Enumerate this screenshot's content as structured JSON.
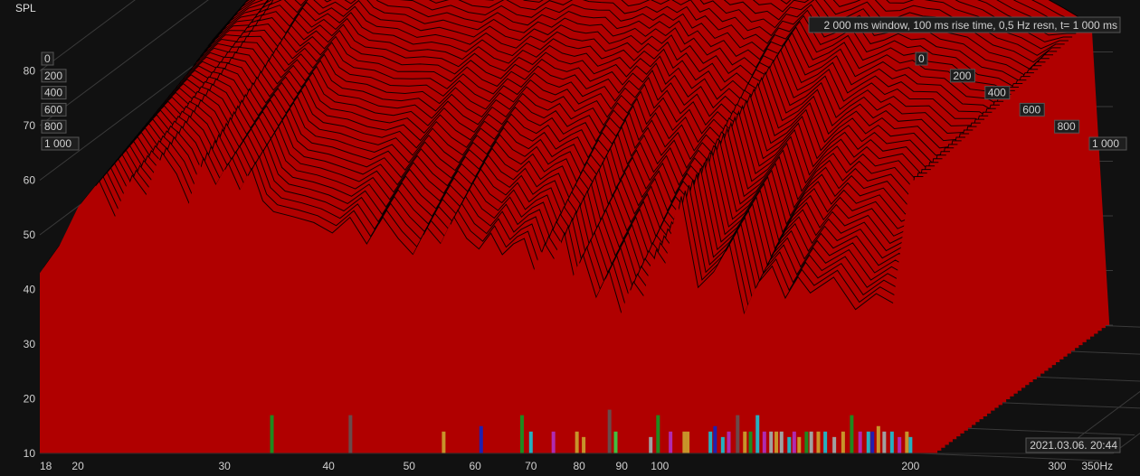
{
  "chart_data": {
    "type": "area",
    "ylabel": "SPL",
    "x_unit": "Hz",
    "x_scale": "log",
    "xlim": [
      18,
      350
    ],
    "ylim": [
      10,
      90
    ],
    "x_ticks": [
      18,
      20,
      30,
      40,
      50,
      60,
      70,
      80,
      90,
      100,
      200,
      300,
      350
    ],
    "x_tick_labels": [
      "18",
      "20",
      "30",
      "40",
      "50",
      "60",
      "70",
      "80",
      "90",
      "100",
      "200",
      "300",
      "350Hz"
    ],
    "y_ticks": [
      10,
      20,
      30,
      40,
      50,
      60,
      70,
      80
    ],
    "y_tick_labels": [
      "10",
      "20",
      "30",
      "40",
      "50",
      "60",
      "70",
      "80"
    ],
    "time_axis_ms": [
      0,
      200,
      400,
      600,
      800,
      1000
    ],
    "time_axis_labels": [
      "0",
      "200",
      "400",
      "600",
      "800",
      "1 000"
    ],
    "annotation": "2 000 ms window, 100 ms rise time,  0,5 Hz resn, t= 1 000 ms",
    "timestamp": "2021.03.06. 20:44",
    "series": [
      {
        "time_ms": 1000,
        "x": [
          18,
          19,
          20,
          21,
          22,
          23,
          24,
          25,
          26,
          27,
          28,
          29,
          30,
          31,
          32,
          33,
          34,
          36,
          38,
          40,
          42,
          44,
          46,
          48,
          50,
          52,
          54,
          56,
          58,
          60,
          62,
          64,
          66,
          68,
          70,
          72,
          74,
          76,
          78,
          80,
          83,
          86,
          89,
          92,
          95,
          98,
          101,
          105,
          110,
          115,
          120,
          125,
          130,
          135,
          140,
          145,
          150,
          160,
          170,
          180,
          190,
          200,
          205
        ],
        "values": [
          43,
          48,
          55,
          59,
          52,
          60,
          56,
          64,
          60,
          54,
          63,
          58,
          62,
          57,
          61,
          55,
          53,
          52,
          51,
          49,
          52,
          47,
          52,
          48,
          45,
          50,
          47,
          52,
          48,
          46,
          49,
          45,
          47,
          48,
          42,
          47,
          44,
          49,
          41,
          45,
          37,
          42,
          34,
          40,
          37,
          46,
          43,
          56,
          39,
          42,
          47,
          34,
          40,
          43,
          37,
          41,
          38,
          41,
          35,
          38,
          36,
          60,
          60
        ]
      },
      {
        "time_ms": 0,
        "x": [
          18,
          20,
          22,
          24,
          26,
          28,
          30,
          32,
          34,
          36,
          38,
          40,
          42,
          45,
          48,
          52,
          56,
          60,
          65,
          70,
          75,
          80,
          85,
          90,
          95,
          100,
          110,
          120,
          130,
          140,
          150,
          160,
          170,
          180,
          190,
          200
        ],
        "values": [
          62,
          70,
          74,
          80,
          88,
          87,
          86,
          87,
          86,
          86,
          84,
          86,
          83,
          85,
          84,
          85,
          85,
          86,
          83,
          85,
          84,
          83,
          82,
          81,
          79,
          80,
          78,
          79,
          77,
          78,
          76,
          74,
          72,
          70,
          68,
          66
        ]
      }
    ],
    "colors": {
      "background": "#111111",
      "surface": "#b00000",
      "ridge_line": "#000000",
      "grid": "#3a3a3a",
      "text": "#d0d0d0"
    },
    "markers": {
      "x": [
        34.2,
        42.5,
        55,
        61,
        68.3,
        70,
        74.5,
        79.5,
        81,
        87,
        88.5,
        97.5,
        99.5,
        103,
        107,
        108,
        115,
        116.5,
        119,
        121,
        124,
        126.5,
        128.5,
        131,
        133.5,
        136,
        138,
        140,
        143,
        145,
        147,
        150,
        152,
        155,
        158,
        162,
        166,
        170,
        174,
        178,
        180,
        183,
        186,
        190,
        194,
        198,
        200
      ],
      "heights": [
        7,
        7,
        4,
        5,
        7,
        4,
        4,
        4,
        3,
        8,
        4,
        3,
        7,
        4,
        4,
        4,
        4,
        5,
        3,
        4,
        7,
        4,
        4,
        7,
        4,
        4,
        4,
        4,
        3,
        4,
        3,
        4,
        4,
        4,
        4,
        3,
        4,
        7,
        4,
        4,
        4,
        5,
        4,
        4,
        3,
        4,
        3
      ],
      "colors": [
        "#1f8a1f",
        "#6a4a4a",
        "#c8942a",
        "#2020b0",
        "#1f8a1f",
        "#25b0c0",
        "#b02ab0",
        "#c8942a",
        "#c8942a",
        "#6a4a4a",
        "#40c040",
        "#a0a0a0",
        "#1f8a1f",
        "#b02ab0",
        "#c8942a",
        "#c8942a",
        "#25b0c0",
        "#2020b0",
        "#25b0c0",
        "#b02ab0",
        "#6a4a4a",
        "#c8942a",
        "#1f8a1f",
        "#25b0c0",
        "#b02ab0",
        "#a0a0a0",
        "#c8942a",
        "#a0a0a0",
        "#25b0c0",
        "#b02ab0",
        "#c8942a",
        "#1f8a1f",
        "#a0a0a0",
        "#c8942a",
        "#25b0c0",
        "#a0a0a0",
        "#c8942a",
        "#1f8a1f",
        "#b02ab0",
        "#25b0c0",
        "#2020b0",
        "#c8942a",
        "#a0a0a0",
        "#25b0c0",
        "#b02ab0",
        "#c8942a",
        "#25b0c0"
      ]
    }
  }
}
